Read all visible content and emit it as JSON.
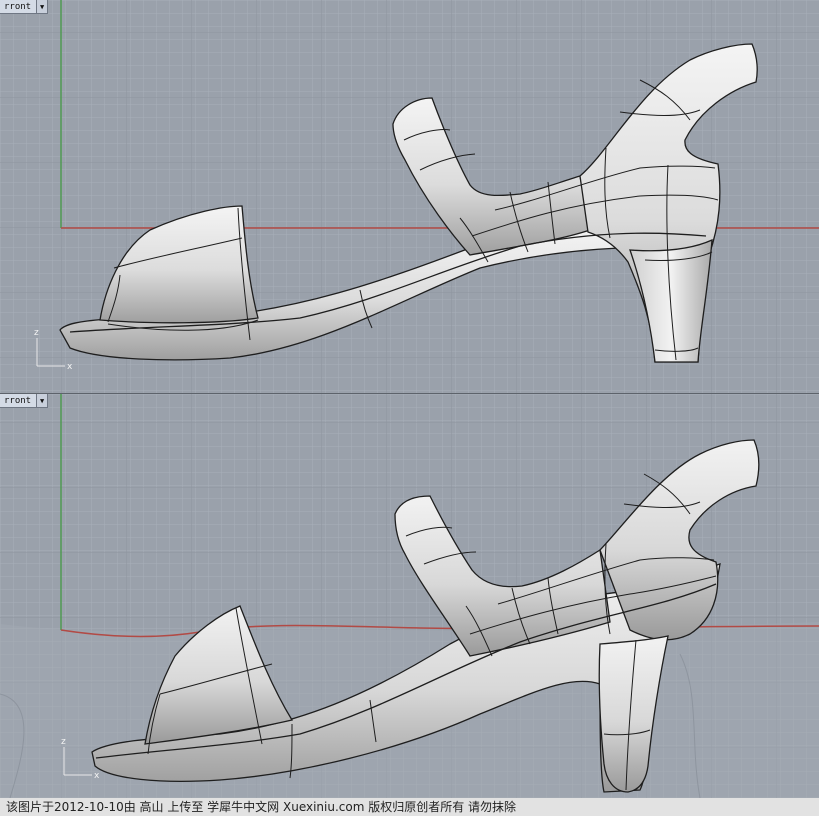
{
  "viewports": {
    "top": {
      "title": "rront",
      "axis_x": "x",
      "axis_z": "z"
    },
    "bottom": {
      "title": "rront",
      "axis_x": "x",
      "axis_z": "z"
    }
  },
  "caption": "该图片于2012-10-10由 高山 上传至 学犀牛中文网 Xuexiniu.com 版权归原创者所有 请勿抹除",
  "colors": {
    "viewport_bg": "#9aa1ab",
    "grid_minor": "#a7aeb8",
    "grid_major": "#8b929c",
    "axis_red": "#b24a45",
    "axis_green": "#4f9a52",
    "surface": "#e4e4e4"
  }
}
